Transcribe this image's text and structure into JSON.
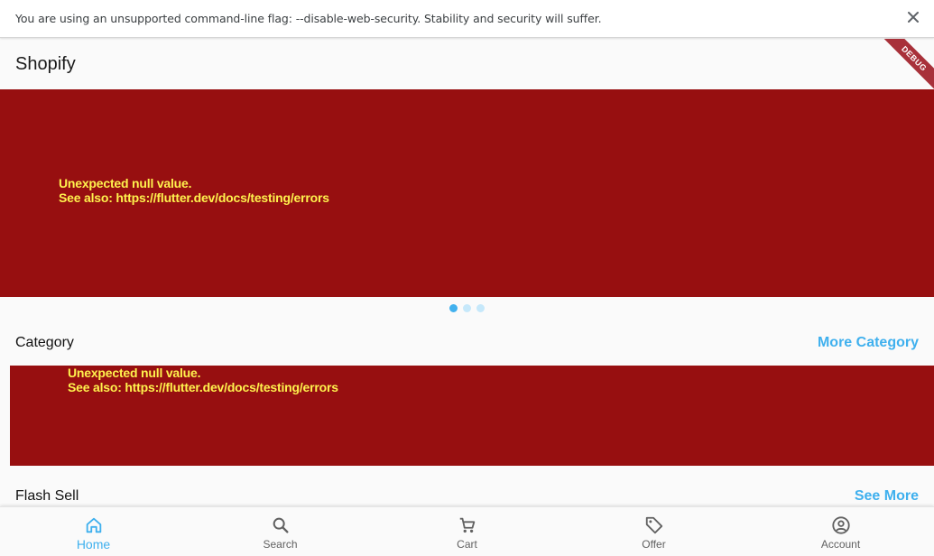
{
  "infobar": {
    "message": "You are using an unsupported command-line flag: --disable-web-security. Stability and security will suffer.",
    "close_icon": "close-icon"
  },
  "appbar": {
    "title": "Shopify",
    "debug_label": "DEBUG"
  },
  "banner": {
    "error_text": "Unexpected null value.\nSee also: https://flutter.dev/docs/testing/errors",
    "dots": [
      {
        "active": true
      },
      {
        "active": false
      },
      {
        "active": false
      }
    ]
  },
  "category": {
    "title": "Category",
    "link": "More Category",
    "error_text": "Unexpected null value.\nSee also: https://flutter.dev/docs/testing/errors"
  },
  "flash": {
    "title": "Flash Sell",
    "link": "See More"
  },
  "bottom_nav": {
    "items": [
      {
        "label": "Home",
        "icon": "home-icon",
        "active": true
      },
      {
        "label": "Search",
        "icon": "search-icon",
        "active": false
      },
      {
        "label": "Cart",
        "icon": "cart-icon",
        "active": false
      },
      {
        "label": "Offer",
        "icon": "tag-icon",
        "active": false
      },
      {
        "label": "Account",
        "icon": "account-icon",
        "active": false
      }
    ]
  },
  "colors": {
    "accent": "#3fb0ee",
    "error_background": "#970f10",
    "error_text": "#fff24d",
    "debug_banner": "#a8313a"
  }
}
